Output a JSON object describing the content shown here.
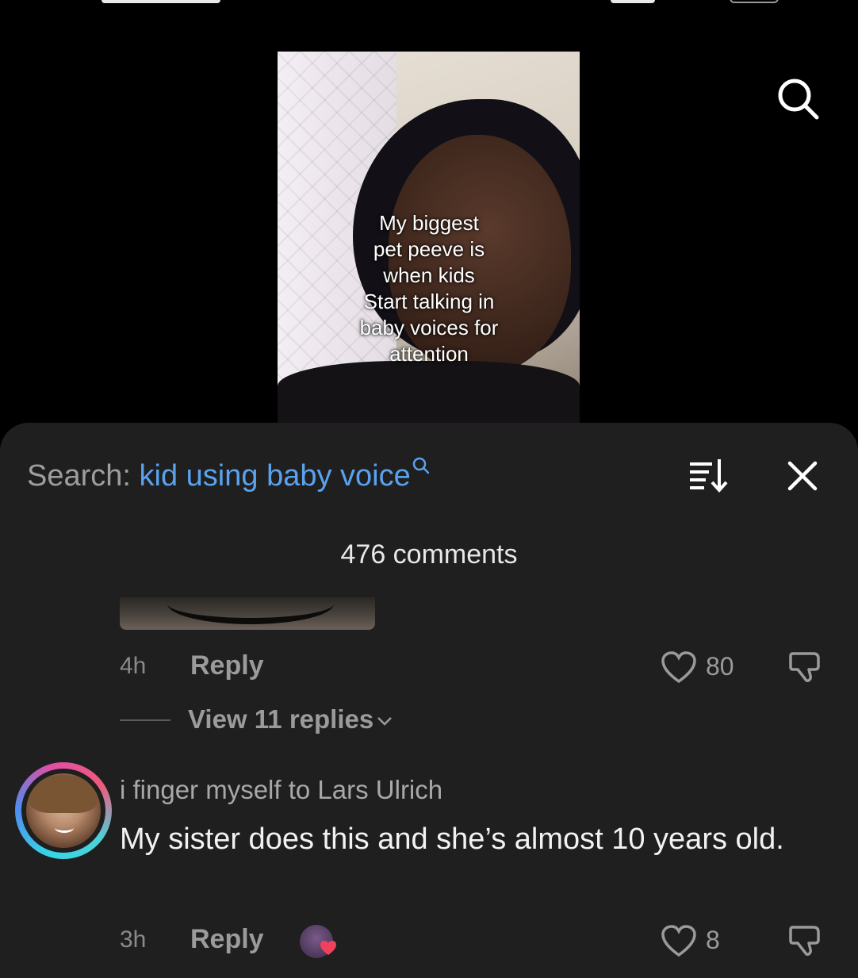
{
  "video": {
    "caption_lines": [
      "My biggest",
      "pet peeve is",
      "when kids",
      "Start talking in",
      "baby voices for",
      "attention"
    ]
  },
  "search": {
    "prefix": "Search:",
    "query": "kid using baby voice"
  },
  "comments_header": {
    "count_label": "476 comments"
  },
  "comments": [
    {
      "time": "4h",
      "reply_label": "Reply",
      "likes": "80",
      "view_replies": "View 11 replies"
    },
    {
      "username": "i finger myself to Lars Ulrich",
      "text": "My sister does this and she’s almost 10 years old.",
      "time": "3h",
      "reply_label": "Reply",
      "likes": "8"
    }
  ],
  "colors": {
    "background": "#000000",
    "sheet": "#1f1f1f",
    "search_query": "#5aa2ee",
    "muted_text": "#9b9b9b"
  },
  "icons": [
    "search-icon",
    "sort-icon",
    "close-icon",
    "heart-icon",
    "dislike-icon",
    "chevron-down-icon"
  ]
}
